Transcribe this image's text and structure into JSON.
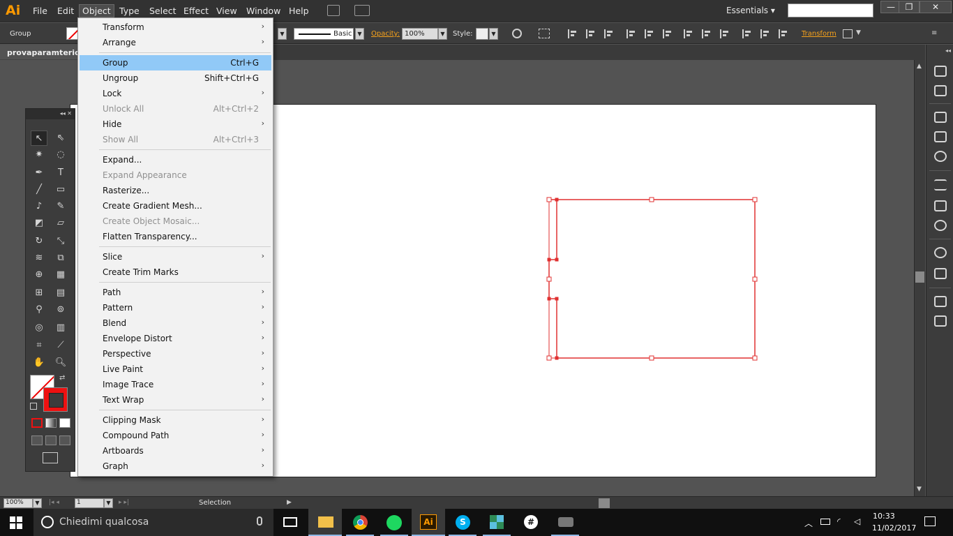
{
  "app": {
    "logo": "Ai",
    "accent": "#ff9a00"
  },
  "menubar": {
    "items": [
      "File",
      "Edit",
      "Object",
      "Type",
      "Select",
      "Effect",
      "View",
      "Window",
      "Help"
    ],
    "active": "Object",
    "workspace": "Essentials",
    "workspace_arrow": "▾",
    "window_controls": [
      "—",
      "❐",
      "✕"
    ]
  },
  "control": {
    "selection_label": "Group",
    "stroke_profile": "Basic",
    "opacity_label": "Opacity:",
    "opacity_value": "100%",
    "style_label": "Style:",
    "transform_label": "Transform"
  },
  "document": {
    "tab_title": "provaparamteric.DX"
  },
  "object_menu": {
    "items": [
      {
        "label": "Transform",
        "shortcut": "",
        "submenu": true,
        "disabled": false
      },
      {
        "label": "Arrange",
        "shortcut": "",
        "submenu": true,
        "disabled": false
      },
      {
        "label": "Group",
        "shortcut": "Ctrl+G",
        "submenu": false,
        "disabled": false,
        "highlighted": true
      },
      {
        "label": "Ungroup",
        "shortcut": "Shift+Ctrl+G",
        "submenu": false,
        "disabled": false
      },
      {
        "label": "Lock",
        "shortcut": "",
        "submenu": true,
        "disabled": false
      },
      {
        "label": "Unlock All",
        "shortcut": "Alt+Ctrl+2",
        "submenu": false,
        "disabled": true
      },
      {
        "label": "Hide",
        "shortcut": "",
        "submenu": true,
        "disabled": false
      },
      {
        "label": "Show All",
        "shortcut": "Alt+Ctrl+3",
        "submenu": false,
        "disabled": true
      },
      {
        "label": "Expand...",
        "shortcut": "",
        "submenu": false,
        "disabled": false
      },
      {
        "label": "Expand Appearance",
        "shortcut": "",
        "submenu": false,
        "disabled": true
      },
      {
        "label": "Rasterize...",
        "shortcut": "",
        "submenu": false,
        "disabled": false
      },
      {
        "label": "Create Gradient Mesh...",
        "shortcut": "",
        "submenu": false,
        "disabled": false
      },
      {
        "label": "Create Object Mosaic...",
        "shortcut": "",
        "submenu": false,
        "disabled": true
      },
      {
        "label": "Flatten Transparency...",
        "shortcut": "",
        "submenu": false,
        "disabled": false
      },
      {
        "label": "Slice",
        "shortcut": "",
        "submenu": true,
        "disabled": false
      },
      {
        "label": "Create Trim Marks",
        "shortcut": "",
        "submenu": false,
        "disabled": false
      },
      {
        "label": "Path",
        "shortcut": "",
        "submenu": true,
        "disabled": false
      },
      {
        "label": "Pattern",
        "shortcut": "",
        "submenu": true,
        "disabled": false
      },
      {
        "label": "Blend",
        "shortcut": "",
        "submenu": true,
        "disabled": false
      },
      {
        "label": "Envelope Distort",
        "shortcut": "",
        "submenu": true,
        "disabled": false
      },
      {
        "label": "Perspective",
        "shortcut": "",
        "submenu": true,
        "disabled": false
      },
      {
        "label": "Live Paint",
        "shortcut": "",
        "submenu": true,
        "disabled": false
      },
      {
        "label": "Image Trace",
        "shortcut": "",
        "submenu": true,
        "disabled": false
      },
      {
        "label": "Text Wrap",
        "shortcut": "",
        "submenu": true,
        "disabled": false
      },
      {
        "label": "Clipping Mask",
        "shortcut": "",
        "submenu": true,
        "disabled": false
      },
      {
        "label": "Compound Path",
        "shortcut": "",
        "submenu": true,
        "disabled": false
      },
      {
        "label": "Artboards",
        "shortcut": "",
        "submenu": true,
        "disabled": false
      },
      {
        "label": "Graph",
        "shortcut": "",
        "submenu": true,
        "disabled": false
      }
    ],
    "highlight_color": "#91c9f7"
  },
  "status": {
    "zoom": "100%",
    "page": "1",
    "tool": "Selection"
  },
  "taskbar": {
    "search_placeholder": "Chiedimi qualcosa",
    "time": "10:33",
    "date": "11/02/2017",
    "apps": [
      "task-view",
      "file-explorer",
      "chrome",
      "spotify",
      "illustrator",
      "skype",
      "app",
      "slack",
      "app"
    ]
  },
  "artwork": {
    "stroke_color": "#e03030"
  }
}
